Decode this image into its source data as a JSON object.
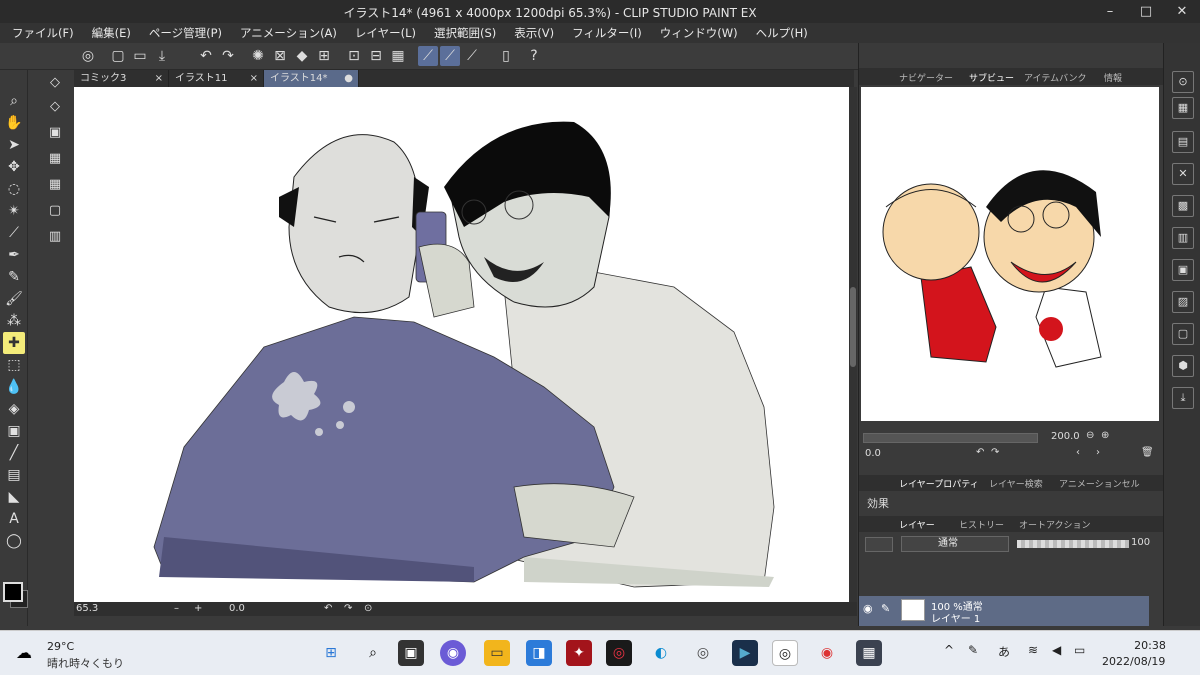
{
  "window": {
    "title": "イラスト14* (4961 x 4000px 1200dpi 65.3%) - CLIP STUDIO PAINT EX",
    "minimize": "–",
    "maximize": "□",
    "close": "✕"
  },
  "menu": [
    "ファイル(F)",
    "編集(E)",
    "ページ管理(P)",
    "アニメーション(A)",
    "レイヤー(L)",
    "選択範囲(S)",
    "表示(V)",
    "フィルター(I)",
    "ウィンドウ(W)",
    "ヘルプ(H)"
  ],
  "tabs": [
    {
      "label": "コミック3",
      "close": "×"
    },
    {
      "label": "イラスト11",
      "close": "×"
    },
    {
      "label": "イラスト14*",
      "close": "●"
    }
  ],
  "canvas_status": {
    "zoom": "65.3",
    "minus": "–",
    "plus": "+",
    "rotation": "0.0"
  },
  "navigator": {
    "tabs": [
      "ナビゲーター",
      "サブビュー",
      "アイテムバンク",
      "情報"
    ],
    "zoom_value": "200.0",
    "rotation_value": "0.0"
  },
  "layer_property": {
    "tabs": [
      "レイヤープロパティ",
      "レイヤー検索",
      "アニメーションセル"
    ],
    "effect_label": "効果"
  },
  "layers": {
    "tabs": [
      "レイヤー",
      "ヒストリー",
      "オートアクション"
    ],
    "blend_mode": "通常",
    "opacity": "100",
    "row": {
      "line1": "100 %通常",
      "line2": "レイヤー 1"
    }
  },
  "taskbar": {
    "temperature": "29°C",
    "weather": "晴れ時々くもり",
    "time": "20:38",
    "date": "2022/08/19",
    "ime": "あ",
    "tray_up": "^"
  }
}
